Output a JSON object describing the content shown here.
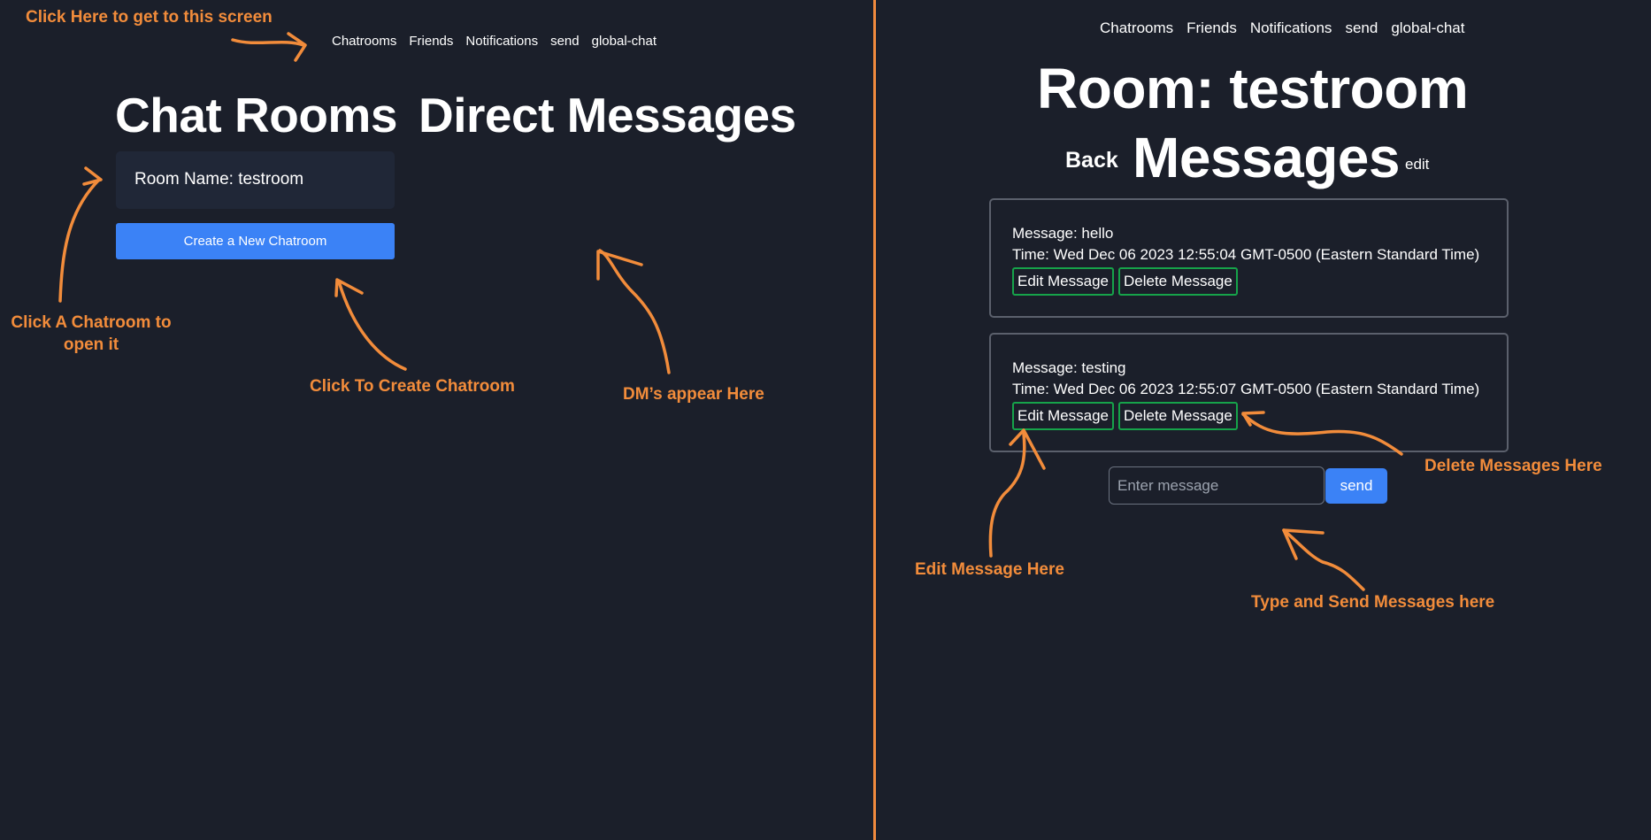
{
  "left_panel": {
    "nav": [
      "Chatrooms",
      "Friends",
      "Notifications",
      "send",
      "global-chat"
    ],
    "chat_rooms_title": "Chat Rooms",
    "direct_messages_title": "Direct Messages",
    "room_card_label": "Room Name: testroom",
    "create_button_label": "Create a New Chatroom"
  },
  "right_panel": {
    "nav": [
      "Chatrooms",
      "Friends",
      "Notifications",
      "send",
      "global-chat"
    ],
    "room_title": "Room: testroom",
    "back_label": "Back",
    "messages_title": "Messages",
    "edit_label": "edit",
    "messages": [
      {
        "text": "Message: hello",
        "time": "Time: Wed Dec 06 2023 12:55:04 GMT-0500 (Eastern Standard Time)",
        "edit_label": "Edit Message",
        "delete_label": "Delete Message"
      },
      {
        "text": "Message: testing",
        "time": "Time: Wed Dec 06 2023 12:55:07 GMT-0500 (Eastern Standard Time)",
        "edit_label": "Edit Message",
        "delete_label": "Delete Message"
      }
    ],
    "input_placeholder": "Enter message",
    "send_label": "send"
  },
  "annotations": {
    "nav_hint": "Click Here to get to this screen",
    "open_room_hint_line1": "Click A Chatroom to",
    "open_room_hint_line2": "open it",
    "create_hint": "Click To Create Chatroom",
    "dm_hint": "DM’s appear Here",
    "delete_hint": "Delete Messages Here",
    "edit_hint": "Edit Message Here",
    "send_hint": "Type and Send Messages here"
  },
  "colors": {
    "background": "#1b1f2a",
    "accent_blue": "#3b82f6",
    "annotation_orange": "#f28c3b",
    "button_border_green": "#16a34a"
  }
}
